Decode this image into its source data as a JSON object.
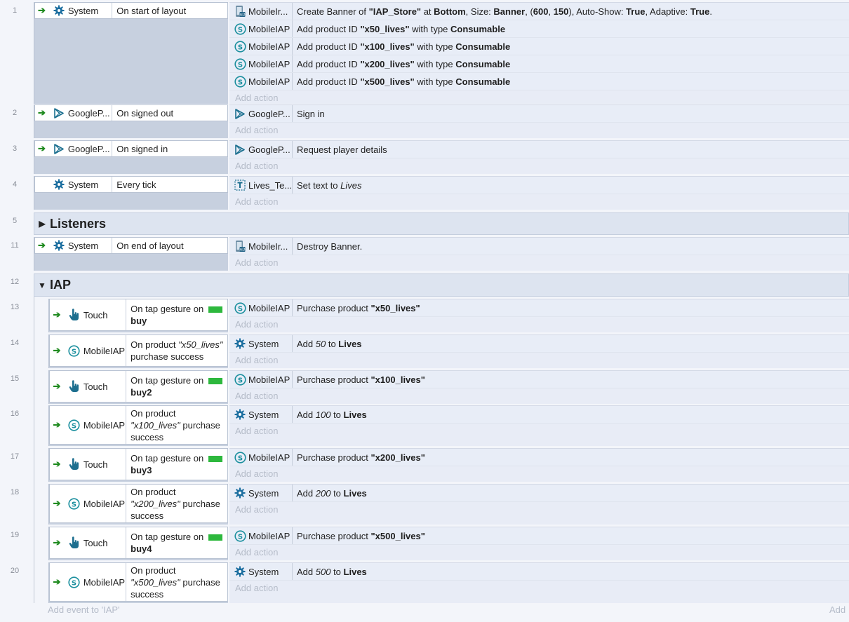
{
  "icons": {
    "gear": "gear-icon",
    "mobileiap": "dollar-circle-icon",
    "play": "google-play-icon",
    "touch": "hand-pointer-icon",
    "mobileads": "phone-ads-icon",
    "text": "text-object-icon",
    "arrow": "trigger-arrow-icon"
  },
  "colors": {
    "accent": "#1d7fb8",
    "trigger_green": "#1f8a1f",
    "swatch_green": "#2db83d"
  },
  "add_action": "Add action",
  "add_event": "Add event to 'IAP'",
  "add_right": "Add",
  "events": [
    {
      "num": "1",
      "obj": "System",
      "cond": "On start of layout",
      "actions": [
        {
          "obj": "MobileIr...",
          "segs": [
            [
              "Create Banner of ",
              ""
            ],
            [
              "\"IAP_Store\"",
              "b"
            ],
            [
              " at ",
              ""
            ],
            [
              "Bottom",
              "b"
            ],
            [
              ", Size: ",
              ""
            ],
            [
              "Banner",
              "b"
            ],
            [
              ", (",
              ""
            ],
            [
              "600",
              "b"
            ],
            [
              ", ",
              ""
            ],
            [
              "150",
              "b"
            ],
            [
              "), Auto-Show: ",
              ""
            ],
            [
              "True",
              "b"
            ],
            [
              ", Adaptive: ",
              ""
            ],
            [
              "True",
              "b"
            ],
            [
              ".",
              ""
            ]
          ]
        },
        {
          "obj": "MobileIAP",
          "segs": [
            [
              "Add product ID ",
              ""
            ],
            [
              "\"x50_lives\"",
              "b"
            ],
            [
              " with type ",
              ""
            ],
            [
              "Consumable",
              "b"
            ]
          ]
        },
        {
          "obj": "MobileIAP",
          "segs": [
            [
              "Add product ID ",
              ""
            ],
            [
              "\"x100_lives\"",
              "b"
            ],
            [
              " with type ",
              ""
            ],
            [
              "Consumable",
              "b"
            ]
          ]
        },
        {
          "obj": "MobileIAP",
          "segs": [
            [
              "Add product ID ",
              ""
            ],
            [
              "\"x200_lives\"",
              "b"
            ],
            [
              " with type ",
              ""
            ],
            [
              "Consumable",
              "b"
            ]
          ]
        },
        {
          "obj": "MobileIAP",
          "segs": [
            [
              "Add product ID ",
              ""
            ],
            [
              "\"x500_lives\"",
              "b"
            ],
            [
              " with type ",
              ""
            ],
            [
              "Consumable",
              "b"
            ]
          ]
        }
      ]
    },
    {
      "num": "2",
      "obj": "GoogleP...",
      "cond": "On signed out",
      "actions": [
        {
          "obj": "GoogleP...",
          "segs": [
            [
              "Sign in",
              ""
            ]
          ]
        }
      ]
    },
    {
      "num": "3",
      "obj": "GoogleP...",
      "cond": "On signed in",
      "actions": [
        {
          "obj": "GoogleP...",
          "segs": [
            [
              "Request player details",
              ""
            ]
          ]
        }
      ]
    },
    {
      "num": "4",
      "obj": "System",
      "cond": "Every tick",
      "actions": [
        {
          "obj": "Lives_Te...",
          "segs": [
            [
              "Set text to ",
              ""
            ],
            [
              "Lives",
              "i"
            ]
          ]
        }
      ]
    },
    {
      "num": "5",
      "group": "Listeners"
    },
    {
      "num": "11",
      "obj": "System",
      "cond": "On end of layout",
      "actions": [
        {
          "obj": "MobileIr...",
          "segs": [
            [
              "Destroy Banner.",
              ""
            ]
          ]
        }
      ]
    },
    {
      "num": "12",
      "group": "IAP"
    },
    {
      "num": "13",
      "obj": "Touch",
      "cond_segs": [
        [
          "On tap gesture on ",
          ""
        ],
        [
          "",
          "sw"
        ],
        [
          "buy",
          "nb"
        ]
      ],
      "actions": [
        {
          "obj": "MobileIAP",
          "segs": [
            [
              "Purchase product ",
              ""
            ],
            [
              "\"x50_lives\"",
              "b"
            ]
          ]
        }
      ]
    },
    {
      "num": "14",
      "obj": "MobileIAP",
      "cond_segs": [
        [
          "On product ",
          ""
        ],
        [
          "\"x50_lives\"",
          "i"
        ],
        [
          "purchase success",
          "n"
        ]
      ],
      "actions": [
        {
          "obj": "System",
          "segs": [
            [
              "Add ",
              ""
            ],
            [
              "50",
              "i"
            ],
            [
              " to ",
              ""
            ],
            [
              "Lives",
              "b"
            ]
          ]
        }
      ]
    },
    {
      "num": "15",
      "obj": "Touch",
      "cond_segs": [
        [
          "On tap gesture on ",
          ""
        ],
        [
          "",
          "sw"
        ],
        [
          "buy2",
          "nb"
        ]
      ],
      "actions": [
        {
          "obj": "MobileIAP",
          "segs": [
            [
              "Purchase product ",
              ""
            ],
            [
              "\"x100_lives\"",
              "b"
            ]
          ]
        }
      ]
    },
    {
      "num": "16",
      "obj": "MobileIAP",
      "cond_segs": [
        [
          "On product",
          ""
        ],
        [
          "\"x100_lives\"",
          "ni"
        ],
        [
          " purchase",
          ""
        ],
        [
          "success",
          "n"
        ]
      ],
      "actions": [
        {
          "obj": "System",
          "segs": [
            [
              "Add ",
              ""
            ],
            [
              "100",
              "i"
            ],
            [
              " to ",
              ""
            ],
            [
              "Lives",
              "b"
            ]
          ]
        }
      ]
    },
    {
      "num": "17",
      "obj": "Touch",
      "cond_segs": [
        [
          "On tap gesture on ",
          ""
        ],
        [
          "",
          "sw"
        ],
        [
          "buy3",
          "nb"
        ]
      ],
      "actions": [
        {
          "obj": "MobileIAP",
          "segs": [
            [
              "Purchase product ",
              ""
            ],
            [
              "\"x200_lives\"",
              "b"
            ]
          ]
        }
      ]
    },
    {
      "num": "18",
      "obj": "MobileIAP",
      "cond_segs": [
        [
          "On product",
          ""
        ],
        [
          "\"x200_lives\"",
          "ni"
        ],
        [
          " purchase",
          ""
        ],
        [
          "success",
          "n"
        ]
      ],
      "actions": [
        {
          "obj": "System",
          "segs": [
            [
              "Add ",
              ""
            ],
            [
              "200",
              "i"
            ],
            [
              " to ",
              ""
            ],
            [
              "Lives",
              "b"
            ]
          ]
        }
      ]
    },
    {
      "num": "19",
      "obj": "Touch",
      "cond_segs": [
        [
          "On tap gesture on ",
          ""
        ],
        [
          "",
          "sw"
        ],
        [
          "buy4",
          "nb"
        ]
      ],
      "actions": [
        {
          "obj": "MobileIAP",
          "segs": [
            [
              "Purchase product ",
              ""
            ],
            [
              "\"x500_lives\"",
              "b"
            ]
          ]
        }
      ]
    },
    {
      "num": "20",
      "obj": "MobileIAP",
      "cond_segs": [
        [
          "On product",
          ""
        ],
        [
          "\"x500_lives\"",
          "ni"
        ],
        [
          " purchase",
          ""
        ],
        [
          "success",
          "n"
        ]
      ],
      "actions": [
        {
          "obj": "System",
          "segs": [
            [
              "Add ",
              ""
            ],
            [
              "500",
              "i"
            ],
            [
              " to ",
              ""
            ],
            [
              "Lives",
              "b"
            ]
          ]
        }
      ]
    }
  ]
}
